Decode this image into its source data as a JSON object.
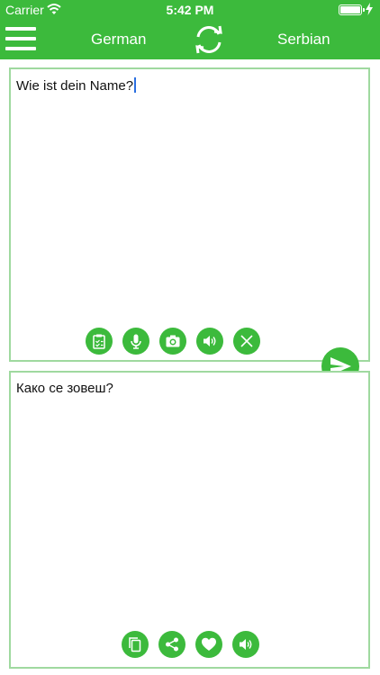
{
  "status": {
    "carrier": "Carrier",
    "time": "5:42 PM"
  },
  "nav": {
    "source_language": "German",
    "target_language": "Serbian"
  },
  "input": {
    "text": "Wie ist dein Name?"
  },
  "output": {
    "text": "Како се зовеш?"
  },
  "colors": {
    "accent": "#3cba3c",
    "panel_border": "#9fd99f",
    "cursor": "#2b6fe0"
  },
  "icons": {
    "input_toolbar": [
      "clipboard-icon",
      "microphone-icon",
      "camera-icon",
      "speaker-icon",
      "close-icon"
    ],
    "output_toolbar": [
      "copy-icon",
      "share-icon",
      "heart-icon",
      "speaker-icon"
    ],
    "send": "send-icon",
    "swap": "swap-icon",
    "menu": "menu-icon"
  }
}
